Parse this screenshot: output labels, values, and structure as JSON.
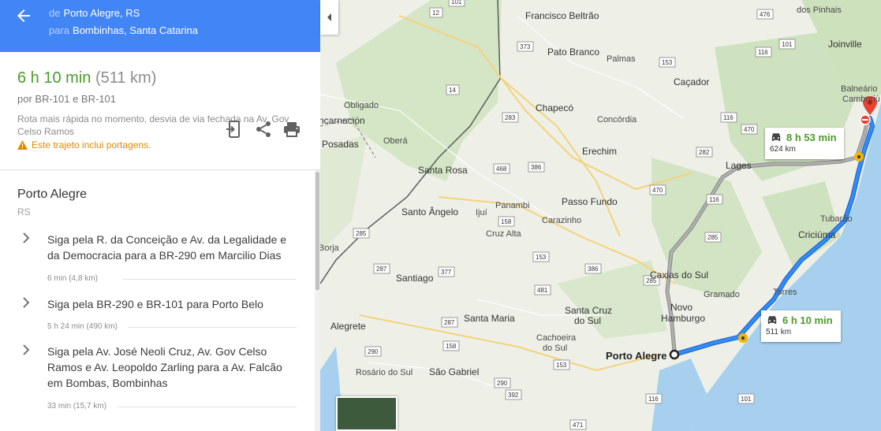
{
  "header": {
    "from_prefix": "de",
    "from_place": "Porto Alegre, RS",
    "to_prefix": "para",
    "to_place": "Bombinhas, Santa Catarina"
  },
  "summary": {
    "duration": "6 h 10 min",
    "distance": "(511 km)",
    "via": "por BR-101 e BR-101",
    "note": "Rota mais rápida no momento, desvia de via fechada na Av. Gov Celso Ramos",
    "toll_warning": "Este trajeto inclui portagens."
  },
  "origin": {
    "name": "Porto Alegre",
    "state": "RS"
  },
  "steps": [
    {
      "text": "Siga pela R. da Conceição e Av. da Legalidade e da Democracia para a BR-290 em Marcilio Dias",
      "meta": "6 min (4,8 km)"
    },
    {
      "text": "Siga pela BR-290 e BR-101 para Porto Belo",
      "meta": "5 h 24 min (490 km)"
    },
    {
      "text": "Siga pela Av. José Neoli Cruz, Av. Gov Celso Ramos e Av. Leopoldo Zarling para a Av. Falcão em Bombas, Bombinhas",
      "meta": "33 min (15,7 km)"
    }
  ],
  "map": {
    "route_main": {
      "duration": "6 h 10 min",
      "distance": "511 km"
    },
    "route_alt": {
      "duration": "8 h 53 min",
      "distance": "624 km"
    },
    "places": {
      "porto_alegre": "Porto Alegre",
      "francisco_beltrao": "Francisco Beltrão",
      "pato_branco": "Pato Branco",
      "palmas": "Palmas",
      "cacador": "Caçador",
      "chapeco": "Chapecó",
      "concordia": "Concórdia",
      "erechim": "Erechim",
      "lages": "Lages",
      "obligado": "Obligado",
      "encarnacion": "ncarnación",
      "posadas": "Posadas",
      "obera": "Oberá",
      "santa_rosa": "Santa Rosa",
      "santo_angelo": "Santo Ângelo",
      "ijui": "Ijuí",
      "panambi": "Panambi",
      "carazinho": "Carazinho",
      "passo_fundo": "Passo Fundo",
      "cruz_alta": "Cruz Alta",
      "borja": "Borja",
      "santiago": "Santiago",
      "caxias_do_sul": "Caxias do Sul",
      "gramado": "Gramado",
      "novo_hamburgo": "Novo\nHamburgo",
      "santa_cruz_do_sul": "Santa Cruz do Sul",
      "santa_maria": "Santa Maria",
      "cachoeira_do_sul": "Cachoeira do Sul",
      "alegrete": "Alegrete",
      "rosario_do_sul": "Rosário do Sul",
      "sao_gabriel": "São Gabriel",
      "torres": "Torres",
      "criciuma": "Criciúma",
      "tubarao": "Tubarão",
      "joinville": "Joinville",
      "balneario": "Balneário Camboriú",
      "dos_pinhais": "dos Pinhais"
    },
    "shields": [
      "12",
      "101",
      "373",
      "153",
      "476",
      "116",
      "101",
      "14",
      "283",
      "116",
      "470",
      "282",
      "468",
      "386",
      "470",
      "116",
      "158",
      "285",
      "285",
      "153",
      "386",
      "287",
      "377",
      "481",
      "287",
      "158",
      "290",
      "290",
      "392",
      "116",
      "101",
      "471",
      "153",
      "285"
    ]
  },
  "colors": {
    "header_blue": "#4285f4",
    "duration_green": "#4c9a2a",
    "toll_orange": "#e08a00",
    "route_blue": "#1a73e8",
    "alt_route_gray": "#9e9e9e",
    "water": "#a6d0ee"
  },
  "icons": [
    "back-arrow-icon",
    "send-to-phone-icon",
    "share-icon",
    "print-icon",
    "warning-icon",
    "chevron-right-icon",
    "car-icon",
    "destination-pin-icon",
    "collapse-panel-icon"
  ]
}
